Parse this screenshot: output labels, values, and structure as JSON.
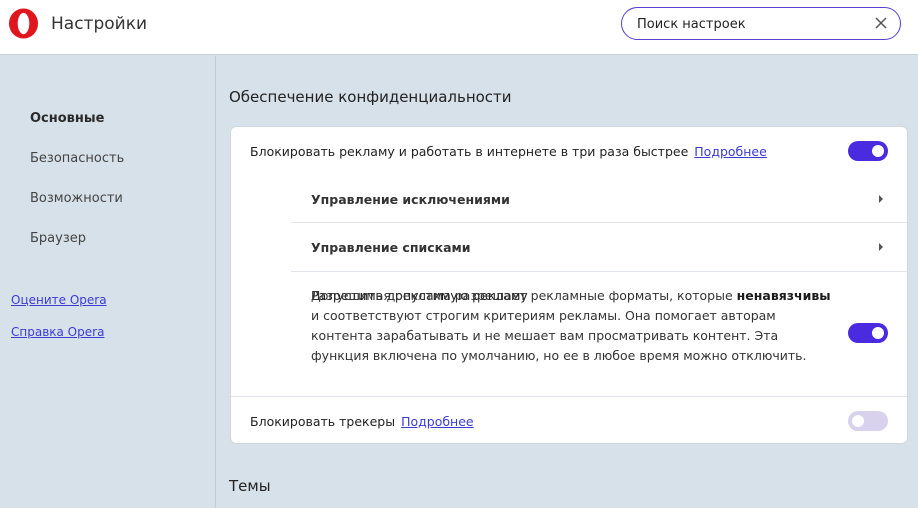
{
  "header": {
    "title": "Настройки",
    "logo_icon": "opera-logo-icon",
    "brand_color": "#e0161f"
  },
  "search": {
    "value": "Поиск настроек",
    "clear_icon": "close-icon"
  },
  "sidebar": {
    "items": [
      {
        "label": "Основные",
        "active": true
      },
      {
        "label": "Безопасность",
        "active": false
      },
      {
        "label": "Возможности",
        "active": false
      },
      {
        "label": "Браузер",
        "active": false
      }
    ],
    "links": [
      {
        "label": "Оцените Opera"
      },
      {
        "label": "Справка Opera"
      }
    ]
  },
  "privacy": {
    "title": "Обеспечение конфиденциальности",
    "block_ads": {
      "label": "Блокировать рекламу и работать в интернете в три раза быстрее",
      "link": "Подробнее",
      "enabled": true
    },
    "manage_exceptions": "Управление исключениями",
    "manage_lists": "Управление списками",
    "acceptable_ads": {
      "title": "Разрешить допустимую рекламу",
      "desc_before": "Допустимая реклама разрешает рекламные форматы, которые ",
      "desc_bold": "ненавязчивы",
      "desc_after": " и соответствуют строгим критериям рекламы. Она помогает авторам контента зарабатывать и не мешает вам просматривать контент. Эта функция включена по умолчанию, но ее в любое время можно отключить.",
      "enabled": true
    },
    "block_trackers": {
      "label": "Блокировать трекеры",
      "link": "Подробнее",
      "enabled": false
    }
  },
  "themes": {
    "title": "Темы"
  },
  "colors": {
    "accent": "#4b2be0",
    "toggle_off": "#d8d2ef",
    "link": "#3b3bd4",
    "background": "#d7e1ea"
  }
}
